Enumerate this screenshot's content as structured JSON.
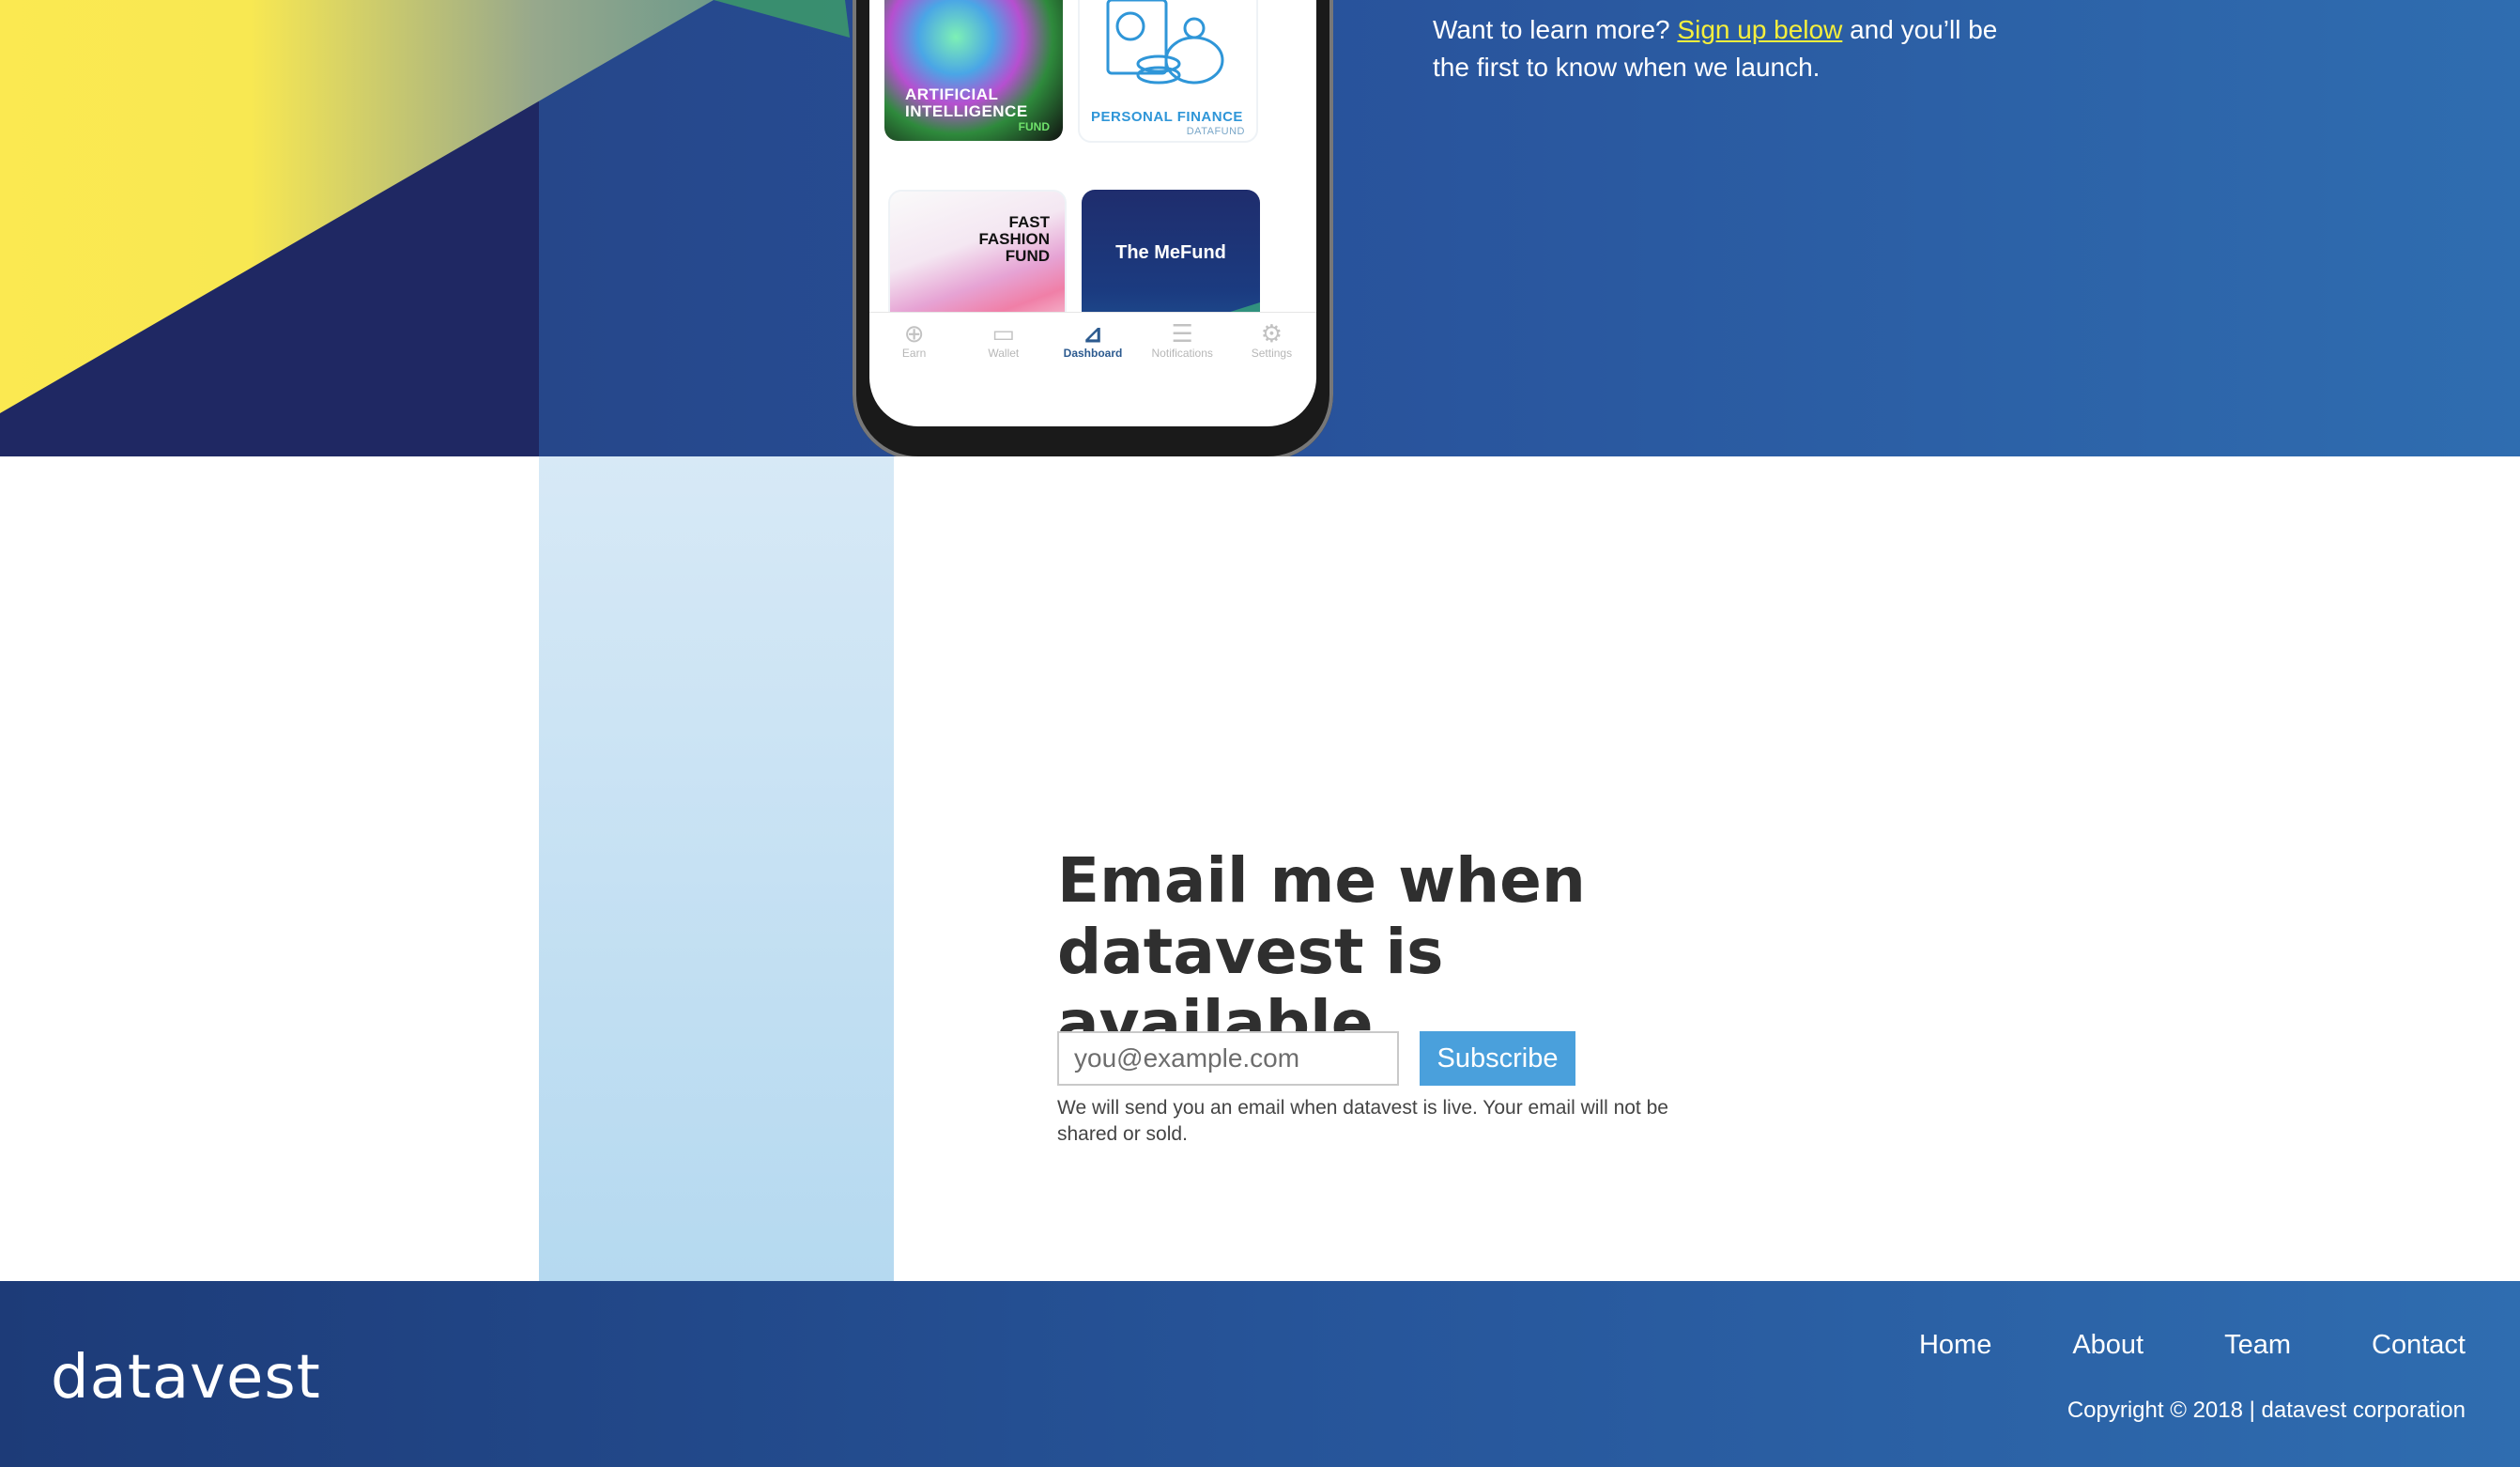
{
  "hero": {
    "text_before": "Want to learn more?",
    "link_text": "Sign up below",
    "text_after": "and you’ll be the first to know when we launch."
  },
  "phone": {
    "tiles": {
      "ai": {
        "line1": "ARTIFICIAL",
        "line2": "INTELLIGENCE",
        "sub": "FUND"
      },
      "pf": {
        "title": "PERSONAL FINANCE",
        "sub": "DATAFUND"
      },
      "ff": {
        "line1": "FAST",
        "line2": "FASHION",
        "line3": "FUND"
      },
      "mf": {
        "title": "The MeFund"
      }
    },
    "tabs": [
      {
        "label": "Earn",
        "icon": "plus-circle-icon"
      },
      {
        "label": "Wallet",
        "icon": "wallet-icon"
      },
      {
        "label": "Dashboard",
        "icon": "chart-icon"
      },
      {
        "label": "Notifications",
        "icon": "list-icon"
      },
      {
        "label": "Settings",
        "icon": "gear-icon"
      }
    ]
  },
  "signup": {
    "title_line1": "Email me when",
    "title_line2": "datavest is available.",
    "email_placeholder": "you@example.com",
    "subscribe_label": "Subscribe",
    "disclaimer": "We will send you an email when datavest is live. Your email will not be shared or sold."
  },
  "footer": {
    "logo": "datavest",
    "nav": [
      "Home",
      "About",
      "Team",
      "Contact"
    ],
    "copyright": "Copyright © 2018 | datavest corporation"
  },
  "colors": {
    "accent": "#4aa0dc",
    "link_yellow": "#f5ef3c",
    "footer_blue": "#27569b"
  }
}
